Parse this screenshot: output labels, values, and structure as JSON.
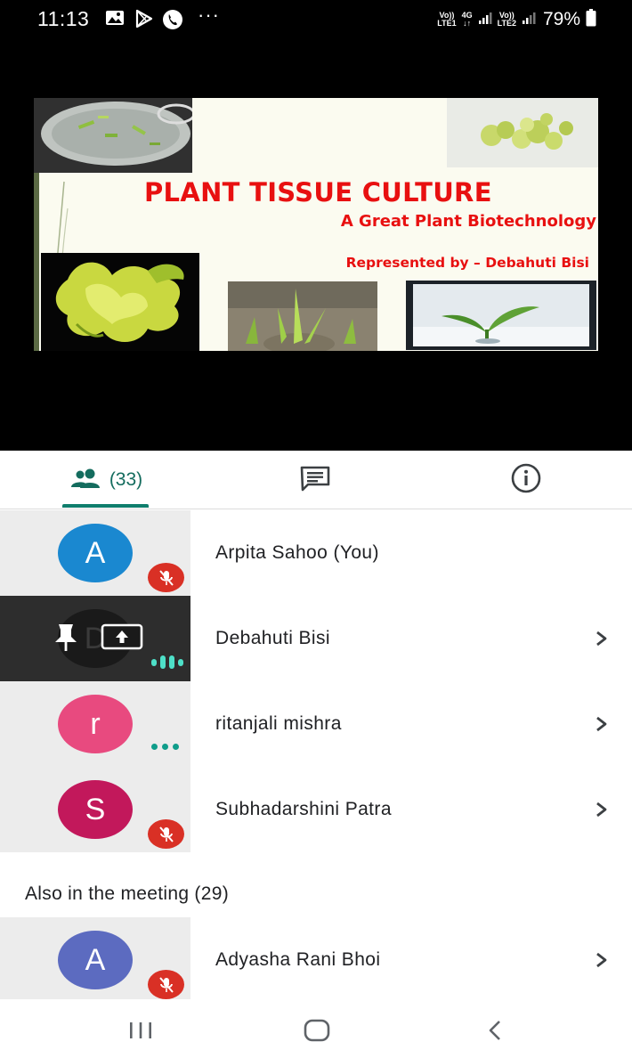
{
  "status_bar": {
    "time": "11:13",
    "icons": [
      "image-icon",
      "play-store-icon",
      "phone-icon"
    ],
    "more": "···",
    "sim1_label_top": "Vo))",
    "sim1_label_bottom": "LTE1",
    "net_label_top": "4G",
    "net_label_bottom": "↓↑",
    "sim2_label_top": "Vo))",
    "sim2_label_bottom": "LTE2",
    "battery": "79%"
  },
  "slide": {
    "title": "PLANT TISSUE CULTURE",
    "subtitle": "A Great Plant Biotechnology",
    "byline": "Represented by – Debahuti Bisi"
  },
  "tabs": {
    "people_count": "(33)",
    "people_icon": "people-icon",
    "chat_icon": "chat-icon",
    "info_icon": "info-icon",
    "accent": "#0f7e6d"
  },
  "participants": [
    {
      "initial": "A",
      "name": "Arpita Sahoo (You)",
      "avatar_color": "#1a88d0",
      "status": "muted"
    },
    {
      "initial": "D",
      "name": "Debahuti Bisi",
      "status": "presenting"
    },
    {
      "initial": "r",
      "name": "ritanjali mishra",
      "avatar_color": "#e84a7f",
      "status": "more"
    },
    {
      "initial": "S",
      "name": "Subhadarshini Patra",
      "avatar_color": "#c2185b",
      "status": "muted"
    }
  ],
  "also_in_meeting": {
    "header": "Also in the meeting (29)",
    "items": [
      {
        "initial": "A",
        "name": "Adyasha Rani Bhoi",
        "avatar_color": "#5c6bc0",
        "status": "muted"
      }
    ]
  },
  "nav": {
    "recents": "recents-icon",
    "home": "home-icon",
    "back": "back-icon"
  }
}
